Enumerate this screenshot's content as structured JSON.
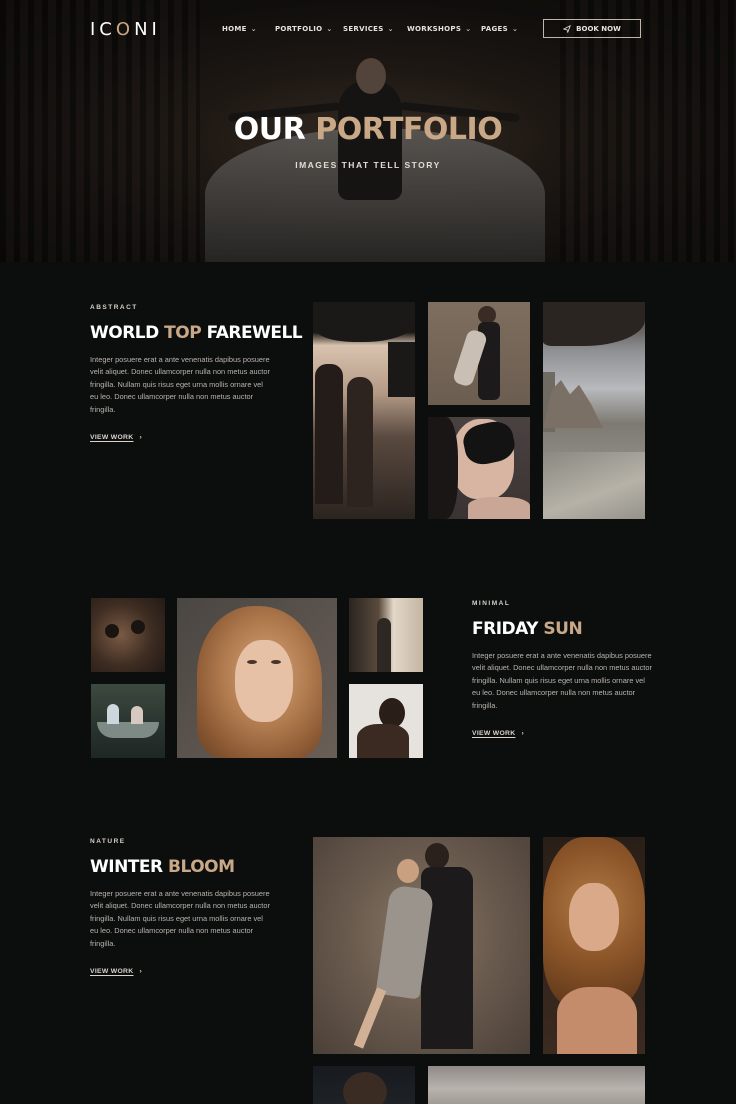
{
  "brand": {
    "logo_pre": "IC",
    "logo_o": "O",
    "logo_post": "NI"
  },
  "nav": [
    {
      "label": "HOME"
    },
    {
      "label": "PORTFOLIO"
    },
    {
      "label": "SERVICES"
    },
    {
      "label": "WORKSHOPS"
    },
    {
      "label": "PAGES"
    }
  ],
  "book_label": "BOOK NOW",
  "hero": {
    "title_a": "OUR ",
    "title_b": "PORTFOLIO",
    "subtitle": "IMAGES THAT TELL STORY"
  },
  "sections": [
    {
      "kicker": "ABSTRACT",
      "title_a": "WORLD ",
      "title_b": "TOP",
      "title_c": " FAREWELL",
      "text": "Integer posuere erat a ante venenatis dapibus posuere velit aliquet. Donec ullamcorper nulla non metus auctor fringilla. Nullam quis risus eget urna mollis ornare vel eu leo. Donec ullamcorper nulla non metus auctor fringilla.",
      "link": "VIEW WORK"
    },
    {
      "kicker": "MINIMAL",
      "title_a": "FRIDAY ",
      "title_b": "SUN",
      "title_c": "",
      "text": "Integer posuere erat a ante venenatis dapibus posuere velit aliquet. Donec ullamcorper nulla non metus auctor fringilla. Nullam quis risus eget urna mollis ornare vel eu leo. Donec ullamcorper nulla non metus auctor fringilla.",
      "link": "VIEW WORK"
    },
    {
      "kicker": "NATURE",
      "title_a": "WINTER ",
      "title_b": "BLOOM",
      "title_c": "",
      "text": "Integer posuere erat a ante venenatis dapibus posuere velit aliquet. Donec ullamcorper nulla non metus auctor fringilla. Nullam quis risus eget urna mollis ornare vel eu leo. Donec ullamcorper nulla non metus auctor fringilla.",
      "link": "VIEW WORK"
    }
  ],
  "colors": {
    "background": "#0c0d0d",
    "accent": "#c9a887",
    "text_muted": "#b9b4ae"
  }
}
